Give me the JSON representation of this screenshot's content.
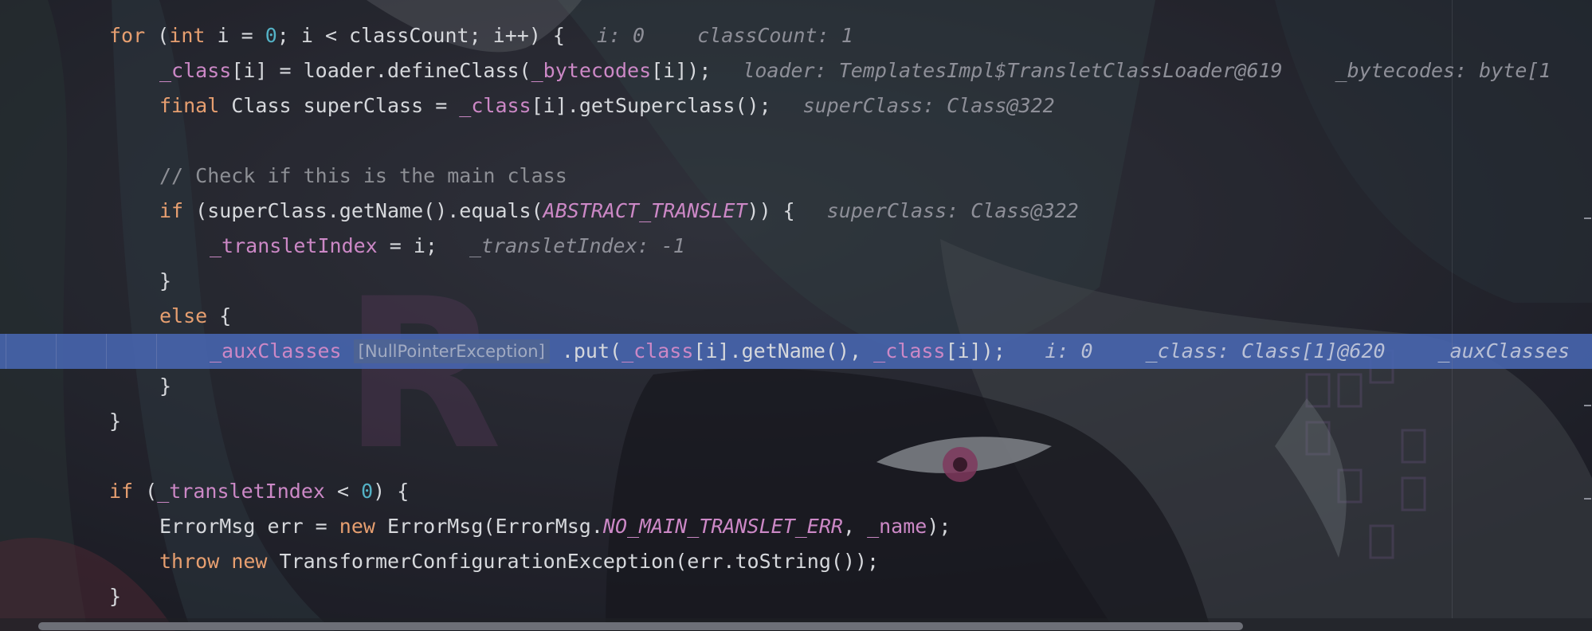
{
  "colors": {
    "background": "#1f2028",
    "keyword": "#e79f70",
    "number": "#54b2c6",
    "field": "#cc88c6",
    "comment": "#8d8f95",
    "text": "#d6d8dc",
    "hint": "#8e8f98",
    "highlight": "#4866b2"
  },
  "lines": [
    {
      "row": 0,
      "indent": 0,
      "tokens": [
        [
          "kw",
          "for"
        ],
        [
          "txt",
          " ("
        ],
        [
          "kw",
          "int"
        ],
        [
          "txt",
          " i = "
        ],
        [
          "num",
          "0"
        ],
        [
          "txt",
          "; i < classCount; i++) {"
        ]
      ],
      "hints": [
        "i: 0",
        "classCount: 1"
      ]
    },
    {
      "row": 1,
      "indent": 1,
      "tokens": [
        [
          "fld",
          "_class"
        ],
        [
          "txt",
          "[i] = loader.defineClass("
        ],
        [
          "fld",
          "_bytecodes"
        ],
        [
          "txt",
          "[i]);"
        ]
      ],
      "hints": [
        "loader: TemplatesImpl$TransletClassLoader@619",
        "_bytecodes: byte[1"
      ]
    },
    {
      "row": 2,
      "indent": 1,
      "tokens": [
        [
          "kw",
          "final"
        ],
        [
          "txt",
          " Class superClass = "
        ],
        [
          "fld",
          "_class"
        ],
        [
          "txt",
          "[i].getSuperclass();"
        ]
      ],
      "hints": [
        "superClass: Class@322"
      ]
    },
    {
      "row": 4,
      "indent": 1,
      "tokens": [
        [
          "cmt",
          "// Check if this is the main class"
        ]
      ],
      "hints": []
    },
    {
      "row": 5,
      "indent": 1,
      "tokens": [
        [
          "kw",
          "if"
        ],
        [
          "txt",
          " (superClass.getName().equals("
        ],
        [
          "cst",
          "ABSTRACT_TRANSLET"
        ],
        [
          "txt",
          ")) {"
        ]
      ],
      "hints": [
        "superClass: Class@322"
      ]
    },
    {
      "row": 6,
      "indent": 2,
      "tokens": [
        [
          "fld",
          "_transletIndex"
        ],
        [
          "txt",
          " = i;"
        ]
      ],
      "hints": [
        "_transletIndex: -1"
      ]
    },
    {
      "row": 7,
      "indent": 1,
      "tokens": [
        [
          "txt",
          "}"
        ]
      ],
      "hints": []
    },
    {
      "row": 8,
      "indent": 1,
      "tokens": [
        [
          "kw",
          "else"
        ],
        [
          "txt",
          " {"
        ]
      ],
      "hints": []
    },
    {
      "row": 9,
      "indent": 2,
      "highlight": true,
      "tokens": [
        [
          "fld",
          "_auxClasses"
        ],
        [
          "txt",
          " "
        ],
        [
          "exc",
          "[NullPointerException]"
        ],
        [
          "txt",
          " .put("
        ],
        [
          "fld",
          "_class"
        ],
        [
          "txt",
          "[i].getName(), "
        ],
        [
          "fld",
          "_class"
        ],
        [
          "txt",
          "[i]);"
        ]
      ],
      "hints": [
        "i: 0",
        "_class: Class[1]@620",
        "_auxClasses"
      ]
    },
    {
      "row": 10,
      "indent": 1,
      "tokens": [
        [
          "txt",
          "}"
        ]
      ],
      "hints": []
    },
    {
      "row": 11,
      "indent": 0,
      "tokens": [
        [
          "txt",
          "}"
        ]
      ],
      "hints": []
    },
    {
      "row": 13,
      "indent": 0,
      "tokens": [
        [
          "kw",
          "if"
        ],
        [
          "txt",
          " ("
        ],
        [
          "fld",
          "_transletIndex"
        ],
        [
          "txt",
          " < "
        ],
        [
          "num",
          "0"
        ],
        [
          "txt",
          ") {"
        ]
      ],
      "hints": []
    },
    {
      "row": 14,
      "indent": 1,
      "tokens": [
        [
          "txt",
          "ErrorMsg err = "
        ],
        [
          "kw",
          "new"
        ],
        [
          "txt",
          " ErrorMsg(ErrorMsg."
        ],
        [
          "cst",
          "NO_MAIN_TRANSLET_ERR"
        ],
        [
          "txt",
          ", "
        ],
        [
          "fld",
          "_name"
        ],
        [
          "txt",
          ");"
        ]
      ],
      "hints": []
    },
    {
      "row": 15,
      "indent": 1,
      "tokens": [
        [
          "kw",
          "throw"
        ],
        [
          "txt",
          " "
        ],
        [
          "kw",
          "new"
        ],
        [
          "txt",
          " TransformerConfigurationException(err.toString());"
        ]
      ],
      "hints": []
    },
    {
      "row": 16,
      "indent": 0,
      "tokens": [
        [
          "txt",
          "}"
        ]
      ],
      "hints": []
    }
  ]
}
